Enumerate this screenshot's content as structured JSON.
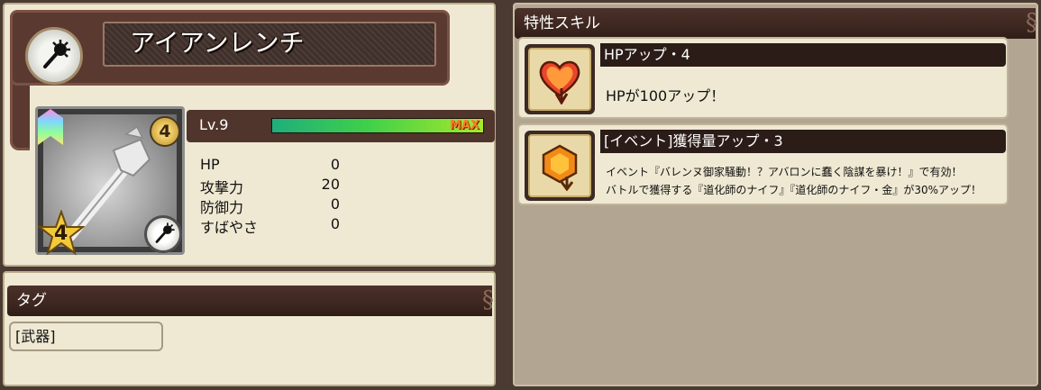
{
  "weapon": {
    "name": "アイアンレンチ",
    "icon": "spiked-mace-icon",
    "level_badge": "4",
    "rarity_stars": "4"
  },
  "level": {
    "label": "Lv.9",
    "progress": 1.0,
    "max_label": "MAX"
  },
  "stats": [
    {
      "label": "HP",
      "value": "0"
    },
    {
      "label": "攻撃力",
      "value": "20"
    },
    {
      "label": "防御力",
      "value": "0"
    },
    {
      "label": "すばやさ",
      "value": "0"
    }
  ],
  "tags": {
    "header": "タグ",
    "items": [
      "[武器]"
    ]
  },
  "skills": {
    "header": "特性スキル",
    "items": [
      {
        "name": "HPアップ・4",
        "icon": "heart-up-icon",
        "description_lines": [
          "HPが100アップ！"
        ]
      },
      {
        "name": "[イベント]獲得量アップ・3",
        "icon": "gem-up-icon",
        "description_lines": [
          "イベント『バレンヌ御家騒動！？アバロンに蠢く陰謀を暴け！』で有効！",
          "バトルで獲得する『道化師のナイフ』『道化師のナイフ・金』が30%アップ！"
        ]
      }
    ]
  },
  "colors": {
    "panel_bg": "#efe9d3",
    "banner_dark": "#3d2720",
    "xp_green": "#3fd04a",
    "max_orange": "#ff7a2a"
  }
}
